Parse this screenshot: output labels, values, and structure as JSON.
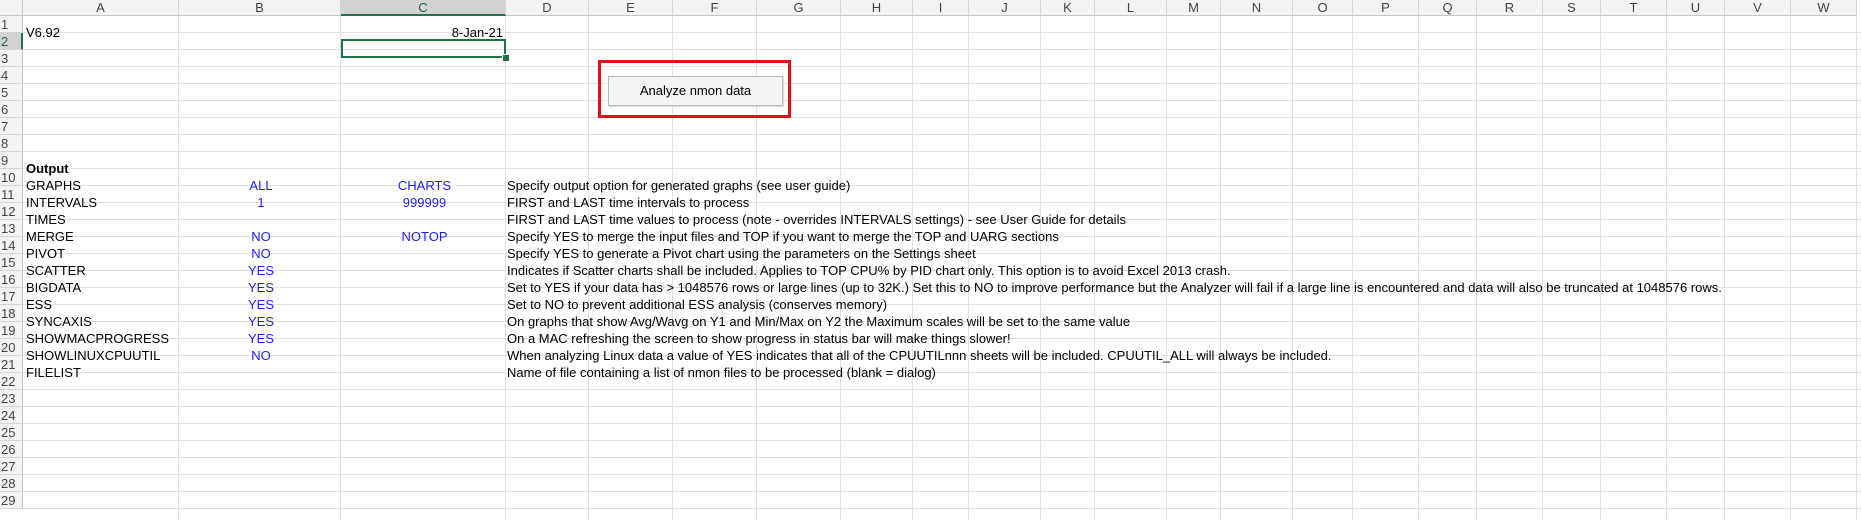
{
  "columns": [
    "A",
    "B",
    "C",
    "D",
    "E",
    "F",
    "G",
    "H",
    "I",
    "J",
    "K",
    "L",
    "M",
    "N",
    "O",
    "P",
    "Q",
    "R",
    "S",
    "T",
    "U",
    "V",
    "W"
  ],
  "selected_column": "C",
  "rows": [
    "1",
    "2",
    "3",
    "4",
    "5",
    "6",
    "7",
    "8",
    "9",
    "10",
    "11",
    "12",
    "13",
    "14",
    "15",
    "16",
    "17",
    "18",
    "19",
    "20",
    "21",
    "22",
    "23",
    "24",
    "25",
    "26",
    "27",
    "28",
    "29"
  ],
  "selected_row": "2",
  "cells": {
    "a1": "V6.92",
    "c1": "8-Jan-21",
    "a9": "Output",
    "a10": "GRAPHS",
    "b10": "ALL",
    "c10": "CHARTS",
    "d10": "Specify output option for generated graphs (see user guide)",
    "a11": "INTERVALS",
    "b11": "1",
    "c11": "999999",
    "d11": "FIRST and LAST time intervals to process",
    "a12": "TIMES",
    "d12": "FIRST and LAST time values to process (note - overrides INTERVALS settings) - see User Guide for details",
    "a13": "MERGE",
    "b13": "NO",
    "c13": "NOTOP",
    "d13": "Specify YES to merge the input files and TOP if you want to merge the TOP and UARG sections",
    "a14": "PIVOT",
    "b14": "NO",
    "d14": "Specify YES to generate a Pivot chart using the parameters on the Settings sheet",
    "a15": "SCATTER",
    "b15": "YES",
    "d15": "Indicates if Scatter charts shall be included.  Applies to TOP CPU% by PID chart only.  This option is to avoid Excel 2013 crash.",
    "a16": "BIGDATA",
    "b16": "YES",
    "d16": "Set to YES if your data has > 1048576 rows or large lines (up to 32K.)  Set this to NO to improve performance but the Analyzer will fail if a large line is encountered and data will also be truncated at 1048576 rows.",
    "a17": "ESS",
    "b17": "YES",
    "d17": "Set to NO to prevent additional ESS analysis (conserves memory)",
    "a18": "SYNCAXIS",
    "b18": "YES",
    "d18": "On graphs that show Avg/Wavg on Y1 and Min/Max on Y2 the Maximum scales will be set to the same value",
    "a19": "SHOWMACPROGRESS",
    "b19": "YES",
    "d19": "On a MAC refreshing the screen to show progress in status bar will make things slower!",
    "a20": "SHOWLINUXCPUUTIL",
    "b20": "NO",
    "d20": "When analyzing Linux data a value of YES indicates that all of the CPUUTILnnn sheets will be included.  CPUUTIL_ALL will always be included.",
    "a21": "FILELIST",
    "d21": "Name of file containing a list of nmon files to be processed (blank = dialog)"
  },
  "button": {
    "label": "Analyze nmon data"
  },
  "colors": {
    "value_blue": "#1f1fe8",
    "selection_green": "#217346",
    "highlight_red": "#e0101a"
  }
}
